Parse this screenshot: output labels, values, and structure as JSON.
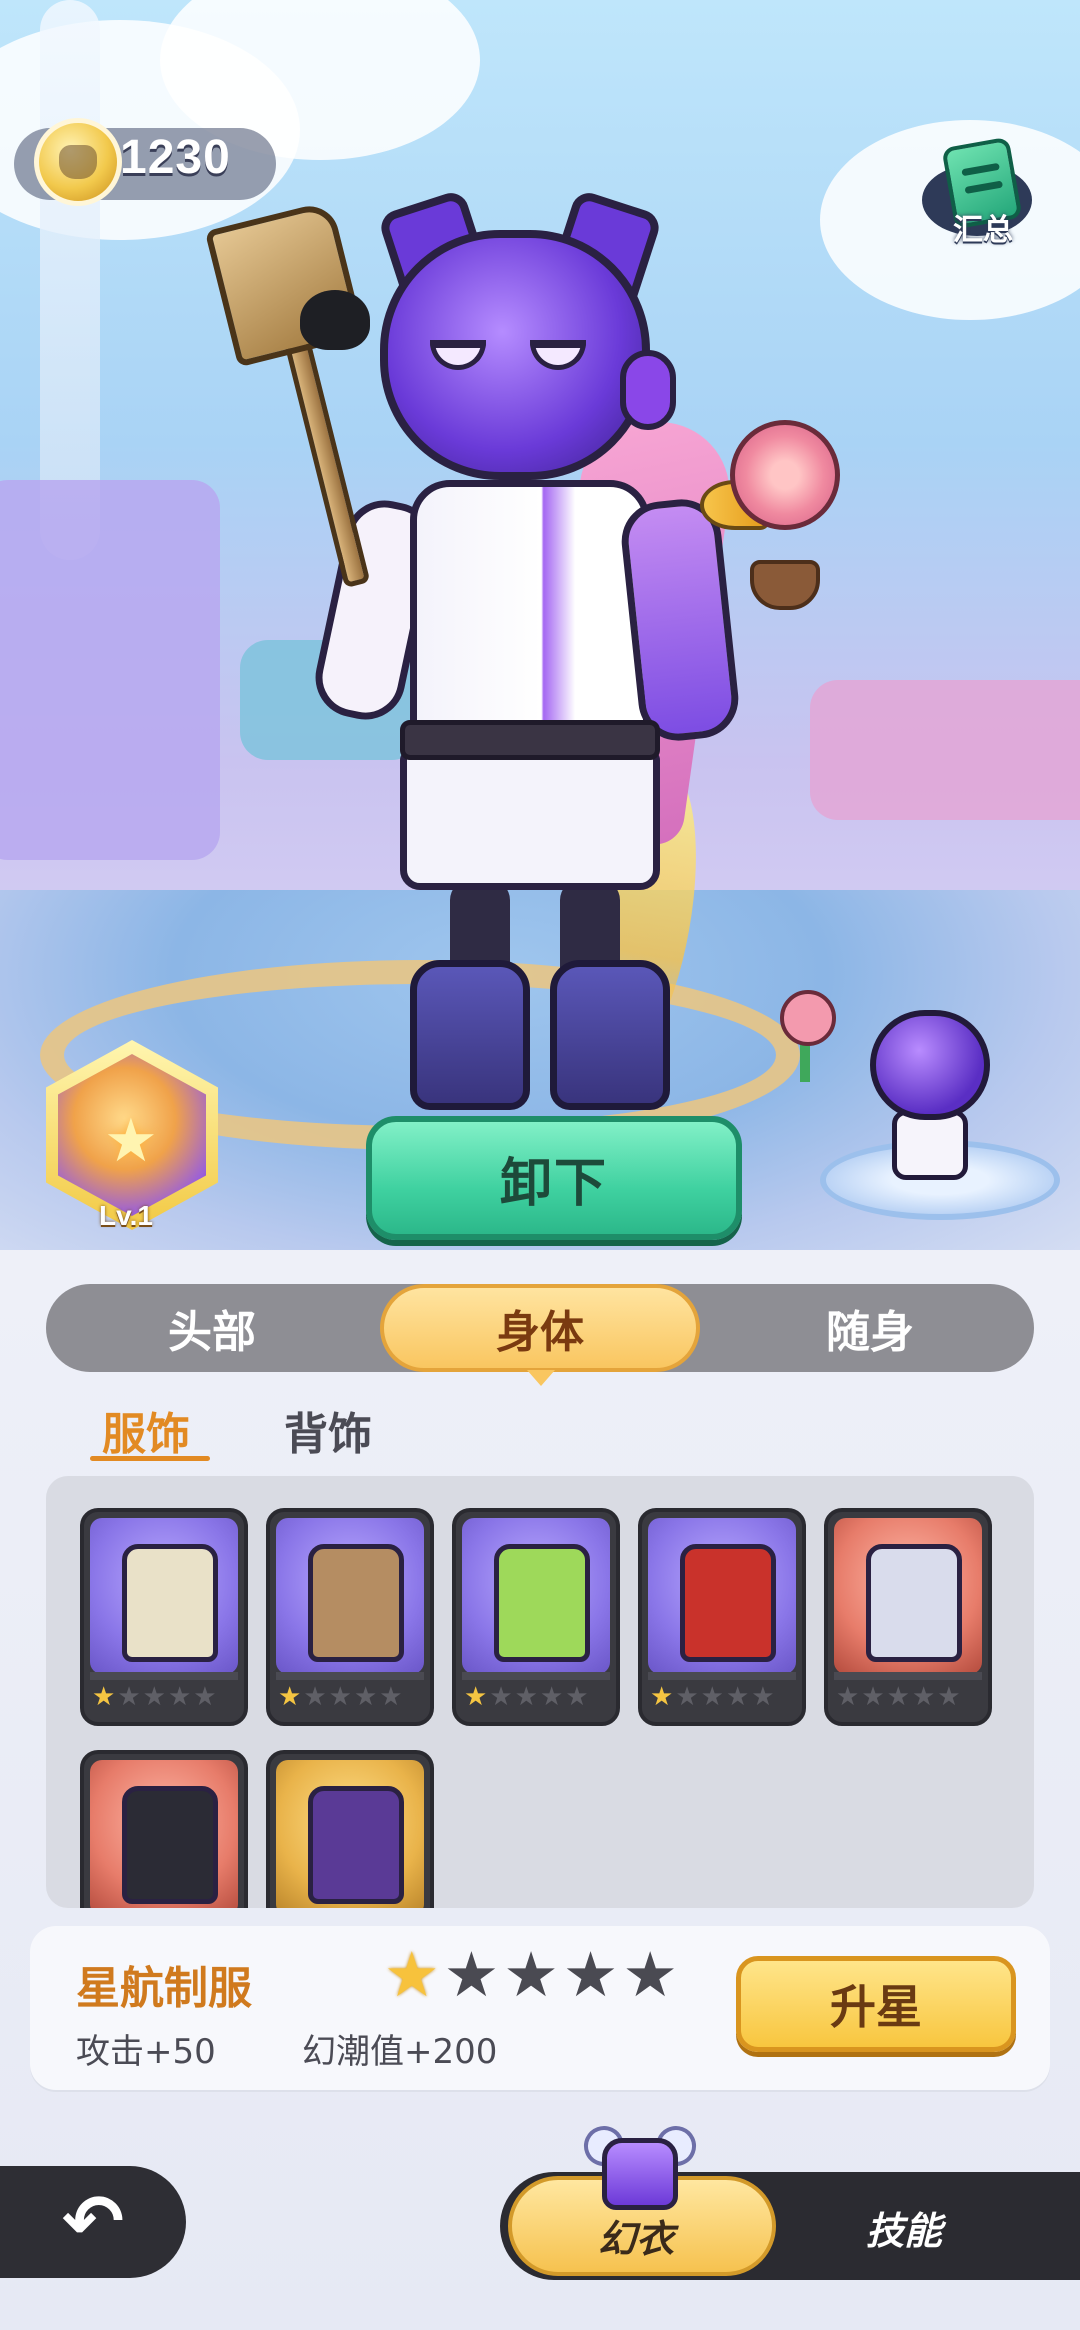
{
  "currency": {
    "icon": "hamster-coin-icon",
    "value": "1230"
  },
  "summary_button": {
    "label": "汇总",
    "icon": "summary-card-icon"
  },
  "character": {
    "level_label": "Lv.1"
  },
  "unequip_button": {
    "label": "卸下"
  },
  "category_tabs": {
    "items": [
      {
        "label": "头部",
        "active": false
      },
      {
        "label": "身体",
        "active": true
      },
      {
        "label": "随身",
        "active": false
      }
    ]
  },
  "sub_tabs": {
    "items": [
      {
        "label": "服饰",
        "active": true
      },
      {
        "label": "背饰",
        "active": false
      }
    ]
  },
  "outfits": {
    "items": [
      {
        "name": "outfit-1",
        "stars": 1,
        "max_stars": 5,
        "bg": "purple",
        "color": "#e9e1c8"
      },
      {
        "name": "outfit-2",
        "stars": 1,
        "max_stars": 5,
        "bg": "purple",
        "color": "#b58d62"
      },
      {
        "name": "outfit-3",
        "stars": 1,
        "max_stars": 5,
        "bg": "purple",
        "color": "#9ed95a"
      },
      {
        "name": "outfit-4",
        "stars": 1,
        "max_stars": 5,
        "bg": "purple",
        "color": "#c9322b"
      },
      {
        "name": "outfit-5",
        "stars": 0,
        "max_stars": 5,
        "bg": "red",
        "color": "#d9dcec"
      },
      {
        "name": "outfit-6",
        "stars": 0,
        "max_stars": 5,
        "bg": "red",
        "color": "#2b2b35"
      },
      {
        "name": "outfit-7",
        "stars": 0,
        "max_stars": 5,
        "bg": "gold",
        "color": "#5a3a96"
      }
    ]
  },
  "selected_item": {
    "name": "星航制服",
    "stars": 1,
    "max_stars": 5,
    "attack": "攻击+50",
    "effect": "幻潮值+200"
  },
  "upgrade_button": {
    "label": "升星"
  },
  "bottom_nav": {
    "back_icon": "back-arrow-icon",
    "tabs": [
      {
        "label": "幻衣",
        "active": true
      },
      {
        "label": "技能",
        "active": false
      }
    ]
  },
  "colors": {
    "accent": "#f9c660",
    "unequip": "#3fd1a0",
    "title": "#d07a1e"
  }
}
